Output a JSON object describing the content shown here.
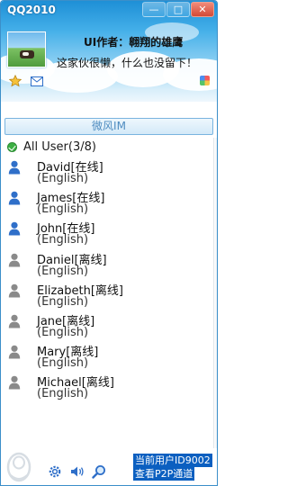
{
  "window": {
    "title": "QQ2010",
    "controls": [
      "minimize-icon",
      "maximize-icon",
      "close-icon"
    ]
  },
  "profile": {
    "author_line": "UI作者：翱翔的雄鹰",
    "signature": "这家伙很懒，什么也没留下！",
    "icons": [
      "status-star-icon",
      "mail-icon",
      "apps-icon"
    ]
  },
  "tab": {
    "label": "微风IM"
  },
  "group": {
    "label": "All User(3/8)"
  },
  "contacts": [
    {
      "name": "David",
      "status": "[在线]",
      "lang": "(English)",
      "online": true
    },
    {
      "name": "James",
      "status": "[在线]",
      "lang": "(English)",
      "online": true
    },
    {
      "name": "John",
      "status": "[在线]",
      "lang": "(English)",
      "online": true
    },
    {
      "name": "Daniel",
      "status": "[离线]",
      "lang": "(English)",
      "online": false
    },
    {
      "name": "Elizabeth",
      "status": "[离线]",
      "lang": "(English)",
      "online": false
    },
    {
      "name": "Jane",
      "status": "[离线]",
      "lang": "(English)",
      "online": false
    },
    {
      "name": "Mary",
      "status": "[离线]",
      "lang": "(English)",
      "online": false
    },
    {
      "name": "Michael",
      "status": "[离线]",
      "lang": "(English)",
      "online": false
    }
  ],
  "footer": {
    "current_user": "当前用户ID9002",
    "p2p_link": "查看P2P通道",
    "tools": [
      "settings-gear-icon",
      "volume-icon",
      "search-icon"
    ]
  },
  "colors": {
    "header_blue": "#1e8fd6",
    "online_icon": "#2f6fc9",
    "offline_icon": "#8a8a8a",
    "group_dot": "#3cb043",
    "footer_highlight": "#0b5fc0"
  }
}
